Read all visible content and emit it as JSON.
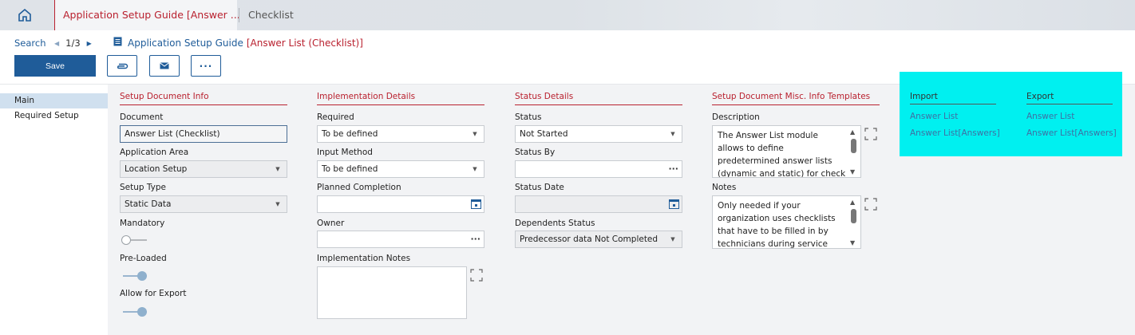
{
  "tabs": {
    "active": "Application Setup Guide [Answer ...",
    "second": "Checklist"
  },
  "header": {
    "search": "Search",
    "pager": "1/3",
    "title": "Application Setup Guide",
    "title_suffix": "[Answer List (Checklist)]"
  },
  "toolbar": {
    "save": "Save",
    "attach_icon": "paperclip-icon",
    "mail_icon": "envelope-icon",
    "more_icon": "more-icon"
  },
  "sidebar": {
    "items": [
      "Main",
      "Required Setup"
    ]
  },
  "setup_doc": {
    "title": "Setup Document Info",
    "document_label": "Document",
    "document_value": "Answer List (Checklist)",
    "area_label": "Application Area",
    "area_value": "Location Setup",
    "type_label": "Setup Type",
    "type_value": "Static Data",
    "mandatory_label": "Mandatory",
    "preloaded_label": "Pre-Loaded",
    "export_label": "Allow for Export"
  },
  "impl": {
    "title": "Implementation Details",
    "required_label": "Required",
    "required_value": "To be defined",
    "method_label": "Input Method",
    "method_value": "To be defined",
    "planned_label": "Planned Completion",
    "planned_value": "",
    "owner_label": "Owner",
    "owner_value": "",
    "notes_label": "Implementation Notes",
    "notes_value": ""
  },
  "status": {
    "title": "Status Details",
    "status_label": "Status",
    "status_value": "Not Started",
    "by_label": "Status By",
    "by_value": "",
    "date_label": "Status Date",
    "date_value": "",
    "dep_label": "Dependents Status",
    "dep_value": "Predecessor data Not Completed"
  },
  "misc": {
    "title": "Setup Document Misc. Info Templates",
    "desc_label": "Description",
    "desc_value": "The Answer List module allows to define predetermined answer lists (dynamic and static) for check lists. It allows",
    "notes_label": "Notes",
    "notes_value": "Only needed if your organization uses checklists that have to be filled in by technicians during service"
  },
  "import_export": {
    "import_title": "Import",
    "import_links": [
      "Answer List",
      "Answer List[Answers]"
    ],
    "export_title": "Export",
    "export_links": [
      "Answer List",
      "Answer List[Answers]"
    ]
  },
  "colors": {
    "accent": "#b9212f",
    "primary": "#1f5c99",
    "highlight": "#00f0f0"
  },
  "toggles": {
    "mandatory": false,
    "preloaded": true,
    "allow_export": true
  }
}
